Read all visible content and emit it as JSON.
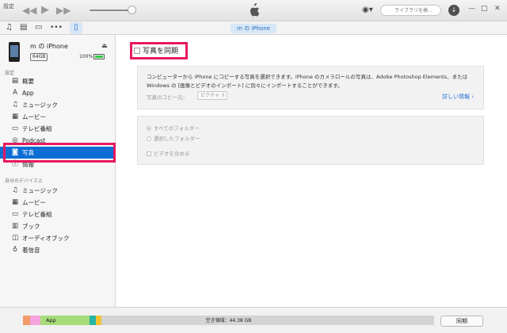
{
  "toolbar": {
    "menu_label": "設定",
    "search_placeholder": "ライブラリを検...",
    "acct_icon": "person-circle-icon",
    "win_min": "—",
    "win_max": "□",
    "win_close": "✕"
  },
  "subbar": {
    "device_pill": "m の iPhone",
    "icons": [
      "music-icon",
      "film-icon",
      "tv-icon",
      "more-icon",
      "iphone-icon"
    ]
  },
  "device": {
    "name": "m の iPhone",
    "capacity": "64GB",
    "battery_pct": "100%",
    "battery_level": 1.0
  },
  "sidebar": {
    "settings_header": "設定",
    "settings_items": [
      {
        "label": "概要",
        "icon": "summary-icon"
      },
      {
        "label": "App",
        "icon": "app-icon"
      },
      {
        "label": "ミュージック",
        "icon": "music-icon"
      },
      {
        "label": "ムービー",
        "icon": "film-icon"
      },
      {
        "label": "テレビ番組",
        "icon": "tv-icon"
      },
      {
        "label": "Podcast",
        "icon": "podcast-icon"
      },
      {
        "label": "写真",
        "icon": "camera-icon",
        "selected": true
      },
      {
        "label": "情報",
        "icon": "info-icon"
      }
    ],
    "ondevice_header": "自分のデバイス上",
    "ondevice_items": [
      {
        "label": "ミュージック",
        "icon": "music-icon"
      },
      {
        "label": "ムービー",
        "icon": "film-icon"
      },
      {
        "label": "テレビ番組",
        "icon": "tv-icon"
      },
      {
        "label": "ブック",
        "icon": "book-icon"
      },
      {
        "label": "オーディオブック",
        "icon": "audiobook-icon"
      },
      {
        "label": "着信音",
        "icon": "bell-icon"
      }
    ]
  },
  "main": {
    "sync_label": "写真を同期",
    "description": "コンピューターから iPhone にコピーする写真を選択できます。iPhone のカメラロールの写真は、Adobe Photoshop Elements、または Windows の [画像とビデオのインポート] に別々にインポートすることができます。",
    "copy_from_label": "写真のコピー元：",
    "copy_from_value": "ピクチャ",
    "more_info": "詳しい情報",
    "options": {
      "all_folders": "すべてのフォルダー",
      "selected_folders": "選択したフォルダー",
      "include_videos": "ビデオを含める"
    }
  },
  "storage": {
    "app_label": "App",
    "free_label": "空き領域：44.38 GB",
    "segments": [
      {
        "color": "#f19a6a",
        "frac": 0.018
      },
      {
        "color": "#f4a3dc",
        "frac": 0.024
      },
      {
        "color": "#a6dc7a",
        "frac": 0.12
      },
      {
        "color": "#28b5a4",
        "frac": 0.016
      },
      {
        "color": "#f1c232",
        "frac": 0.013
      }
    ],
    "sync_button": "同期"
  },
  "colors": {
    "selection": "#0c6dd4",
    "highlight_box": "#e8185f",
    "link": "#2a72d6"
  }
}
